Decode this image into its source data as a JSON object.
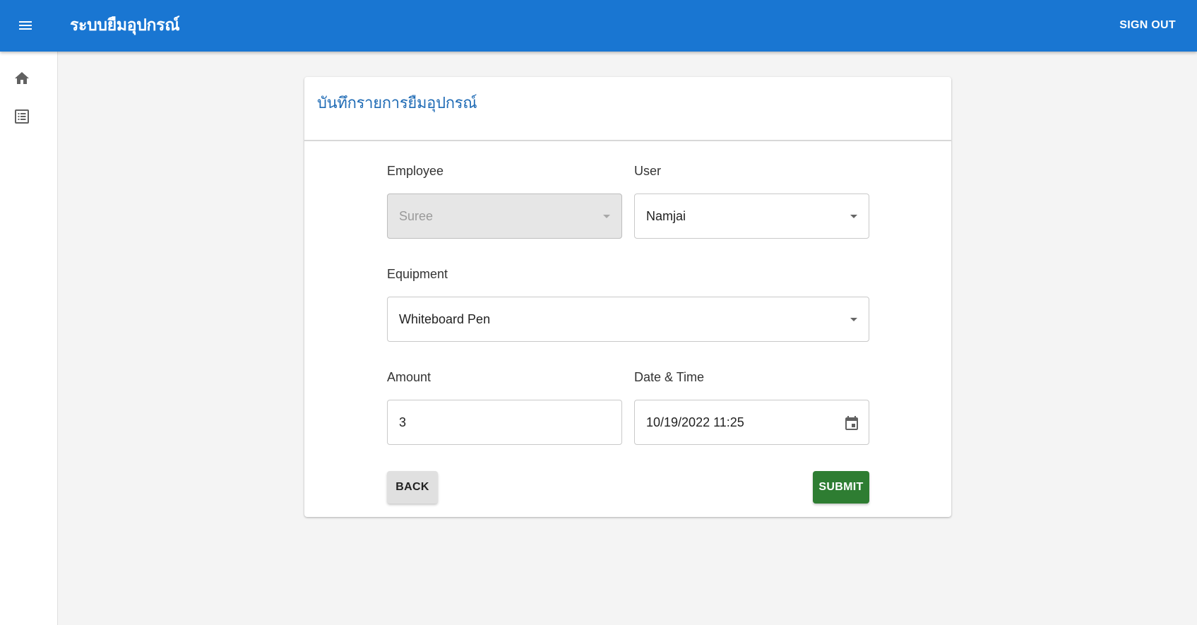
{
  "appbar": {
    "menu_icon": "menu-icon",
    "title": "ระบบยืมอุปกรณ์",
    "signout_label": "SIGN OUT",
    "color": "#1976d2"
  },
  "sidebar": {
    "items": [
      {
        "icon": "home-icon"
      },
      {
        "icon": "list-icon"
      }
    ]
  },
  "form": {
    "title": "บันทึกรายการยืมอุปกรณ์",
    "employee": {
      "label": "Employee",
      "value": "Suree",
      "disabled": true
    },
    "user": {
      "label": "User",
      "value": "Namjai"
    },
    "equipment": {
      "label": "Equipment",
      "value": "Whiteboard Pen"
    },
    "amount": {
      "label": "Amount",
      "value": "3"
    },
    "datetime": {
      "label": "Date & Time",
      "value": "10/19/2022 11:25",
      "icon": "calendar-icon"
    },
    "back_label": "BACK",
    "submit_label": "SUBMIT",
    "submit_color": "#2e7d32"
  }
}
